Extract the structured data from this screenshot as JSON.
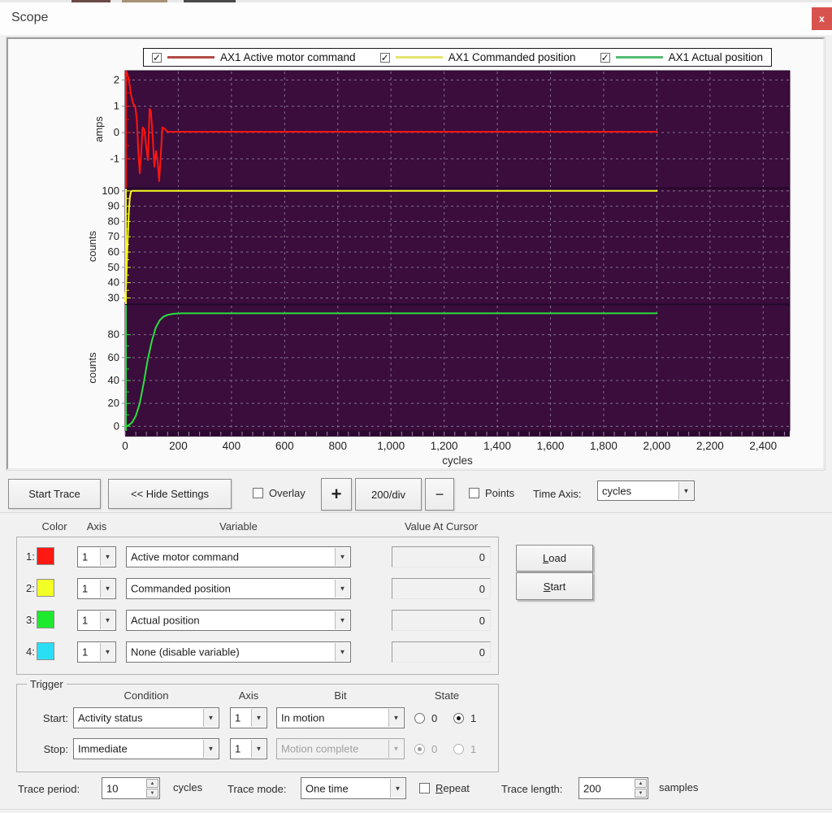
{
  "window": {
    "title": "Scope",
    "close": "x"
  },
  "legend": {
    "items": [
      {
        "label": "AX1 Active motor command",
        "color": "#b24a46",
        "checked": true
      },
      {
        "label": "AX1 Commanded position",
        "color": "#e4e46c",
        "checked": true
      },
      {
        "label": "AX1 Actual position",
        "color": "#55bd72",
        "checked": true
      }
    ]
  },
  "chart_data": {
    "type": "line",
    "xlabel": "cycles",
    "xlim": [
      0,
      2500
    ],
    "xticks": [
      0,
      200,
      400,
      600,
      800,
      1000,
      1200,
      1400,
      1600,
      1800,
      2000,
      2200,
      2400
    ],
    "grid": true,
    "background": "#3a0d3c",
    "grid_color": "#8d7a96",
    "frame_color": "#23062a",
    "band_color": "#2d0931",
    "subplots": [
      {
        "ylabel": "amps",
        "ylim": [
          -2.1,
          2.35
        ],
        "yticks": [
          2,
          1,
          0,
          -1
        ],
        "series": {
          "name": "AX1 Active motor command",
          "color": "#fe1511",
          "points": [
            [
              0,
              2.2
            ],
            [
              6,
              2.3
            ],
            [
              14,
              2.0
            ],
            [
              22,
              1.45
            ],
            [
              30,
              1.1
            ],
            [
              38,
              1.0
            ],
            [
              44,
              0.5
            ],
            [
              50,
              -0.8
            ],
            [
              55,
              -1.55
            ],
            [
              60,
              -0.85
            ],
            [
              66,
              0.2
            ],
            [
              72,
              0.12
            ],
            [
              80,
              -0.6
            ],
            [
              86,
              -1.05
            ],
            [
              92,
              0.9
            ],
            [
              97,
              0.82
            ],
            [
              104,
              -0.2
            ],
            [
              110,
              -1.3
            ],
            [
              116,
              -0.7
            ],
            [
              122,
              -1.05
            ],
            [
              128,
              -1.85
            ],
            [
              134,
              -0.9
            ],
            [
              140,
              0.2
            ],
            [
              148,
              0.15
            ],
            [
              160,
              0.03
            ],
            [
              400,
              0.03
            ],
            [
              1200,
              0.03
            ],
            [
              2000,
              0.03
            ]
          ]
        }
      },
      {
        "ylabel": "counts",
        "ylim": [
          26,
          101.5
        ],
        "yticks": [
          100,
          90,
          80,
          70,
          60,
          50,
          40,
          30
        ],
        "series": {
          "name": "AX1 Commanded position",
          "color": "#f6fb1f",
          "points": [
            [
              0,
              28
            ],
            [
              3,
              36
            ],
            [
              6,
              50
            ],
            [
              9,
              64
            ],
            [
              12,
              78
            ],
            [
              15,
              89
            ],
            [
              18,
              96
            ],
            [
              22,
              99.5
            ],
            [
              26,
              100
            ],
            [
              500,
              100
            ],
            [
              1200,
              100
            ],
            [
              2000,
              100
            ]
          ]
        }
      },
      {
        "ylabel": "counts",
        "ylim": [
          -4,
          106
        ],
        "yticks": [
          0,
          20,
          40,
          60,
          80
        ],
        "series": {
          "name": "AX1 Actual position",
          "color": "#2ae03e",
          "points": [
            [
              0,
              0
            ],
            [
              10,
              0.5
            ],
            [
              25,
              3
            ],
            [
              40,
              9
            ],
            [
              55,
              20
            ],
            [
              70,
              38
            ],
            [
              85,
              58
            ],
            [
              100,
              74
            ],
            [
              115,
              86
            ],
            [
              130,
              92.5
            ],
            [
              145,
              95.8
            ],
            [
              160,
              97.3
            ],
            [
              180,
              98.2
            ],
            [
              210,
              98.6
            ],
            [
              600,
              98.6
            ],
            [
              1300,
              98.6
            ],
            [
              2000,
              98.6
            ]
          ]
        }
      }
    ]
  },
  "toolbar": {
    "start_trace": "Start Trace",
    "hide_settings": "<< Hide Settings",
    "overlay": "Overlay",
    "overlay_checked": false,
    "zoom_in": "+",
    "div": "200/div",
    "zoom_out": "−",
    "points": "Points",
    "points_checked": false,
    "time_axis_label": "Time Axis:",
    "time_axis_value": "cycles"
  },
  "variables": {
    "headers": {
      "color": "Color",
      "axis": "Axis",
      "variable": "Variable",
      "value": "Value At Cursor"
    },
    "rows": [
      {
        "num": "1:",
        "color": "#fe1a12",
        "axis": "1",
        "variable": "Active motor command",
        "value": "0"
      },
      {
        "num": "2:",
        "color": "#f2ff24",
        "axis": "1",
        "variable": "Commanded position",
        "value": "0"
      },
      {
        "num": "3:",
        "color": "#1fe92e",
        "axis": "1",
        "variable": "Actual position",
        "value": "0"
      },
      {
        "num": "4:",
        "color": "#2adff5",
        "axis": "1",
        "variable": "None (disable variable)",
        "value": "0"
      }
    ]
  },
  "side_buttons": {
    "load": {
      "u": "L",
      "rest": "oad"
    },
    "start": {
      "u": "S",
      "rest": "tart"
    }
  },
  "trigger": {
    "title": "Trigger",
    "headers": {
      "condition": "Condition",
      "axis": "Axis",
      "bit": "Bit",
      "state": "State"
    },
    "start": {
      "label": "Start:",
      "condition": "Activity status",
      "axis": "1",
      "bit": "In motion",
      "state0": "0",
      "state1": "1",
      "selected": "1",
      "enabled": true
    },
    "stop": {
      "label": "Stop:",
      "condition": "Immediate",
      "axis": "1",
      "bit": "Motion complete",
      "state0": "0",
      "state1": "1",
      "selected": "0",
      "enabled": false
    }
  },
  "footer": {
    "trace_period_label": "Trace period:",
    "trace_period_value": "10",
    "trace_period_units": "cycles",
    "trace_mode_label": "Trace mode:",
    "trace_mode_value": "One time",
    "repeat": {
      "u": "R",
      "rest": "epeat"
    },
    "repeat_checked": false,
    "trace_length_label": "Trace length:",
    "trace_length_value": "200",
    "trace_length_units": "samples"
  }
}
